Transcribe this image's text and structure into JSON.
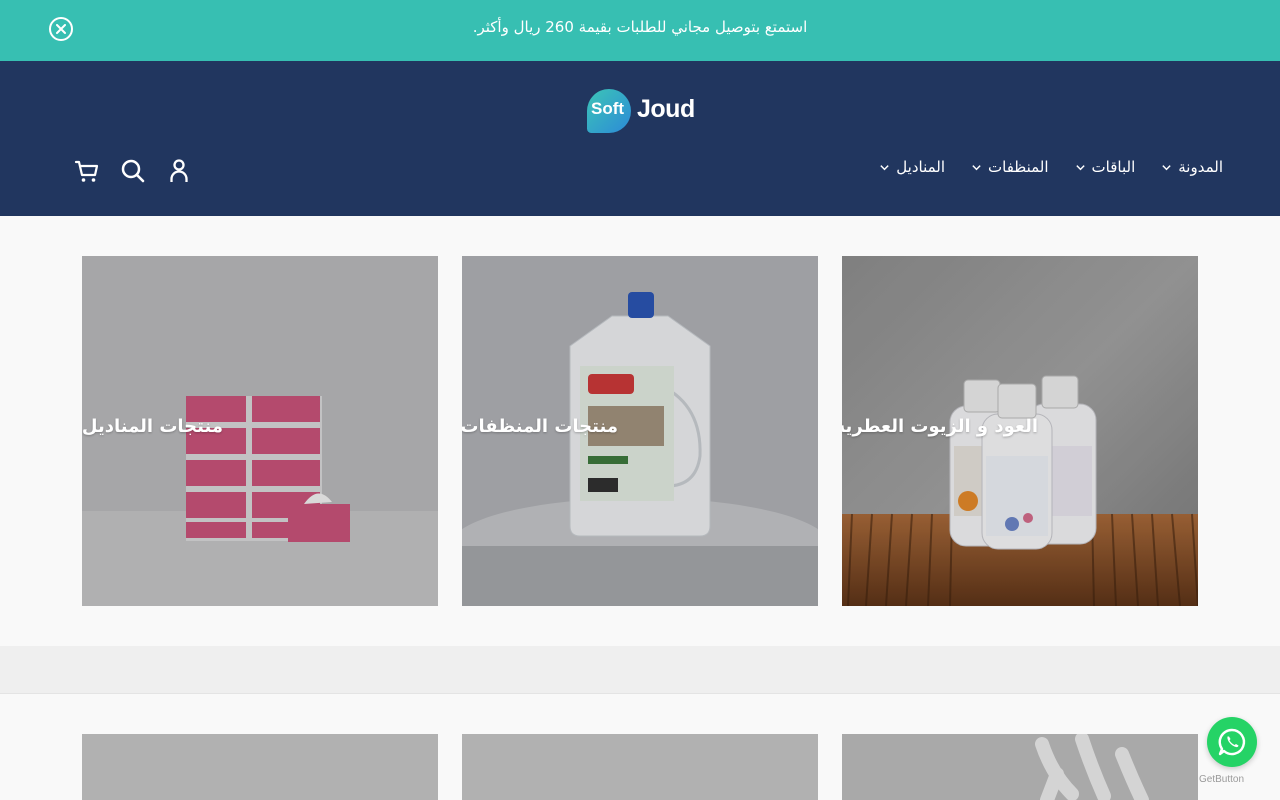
{
  "announcement": {
    "text": "استمتع بتوصيل مجاني للطلبات بقيمة 260 ريال وأكثر.",
    "close_icon": "close-circle-icon"
  },
  "logo": {
    "soft": "Soft",
    "joud": "Joud"
  },
  "nav": [
    {
      "label": "المناديل",
      "icon": "chevron-down-icon"
    },
    {
      "label": "المنظفات",
      "icon": "chevron-down-icon"
    },
    {
      "label": "الباقات",
      "icon": "chevron-down-icon"
    },
    {
      "label": "المدونة",
      "icon": "chevron-down-icon"
    }
  ],
  "header_icons": [
    "cart-icon",
    "search-icon",
    "account-icon"
  ],
  "collections": [
    {
      "title": "العود و الزيوت العطرية"
    },
    {
      "title": "منتجات المنظفات"
    },
    {
      "title": "منتجات المناديل"
    }
  ],
  "whatsapp": {
    "icon": "whatsapp-icon",
    "credit": "GetButton"
  },
  "colors": {
    "announcement_bg": "#37bfb2",
    "header_bg": "#21365f",
    "page_bg": "#f9f9f9",
    "whatsapp": "#25d366"
  }
}
